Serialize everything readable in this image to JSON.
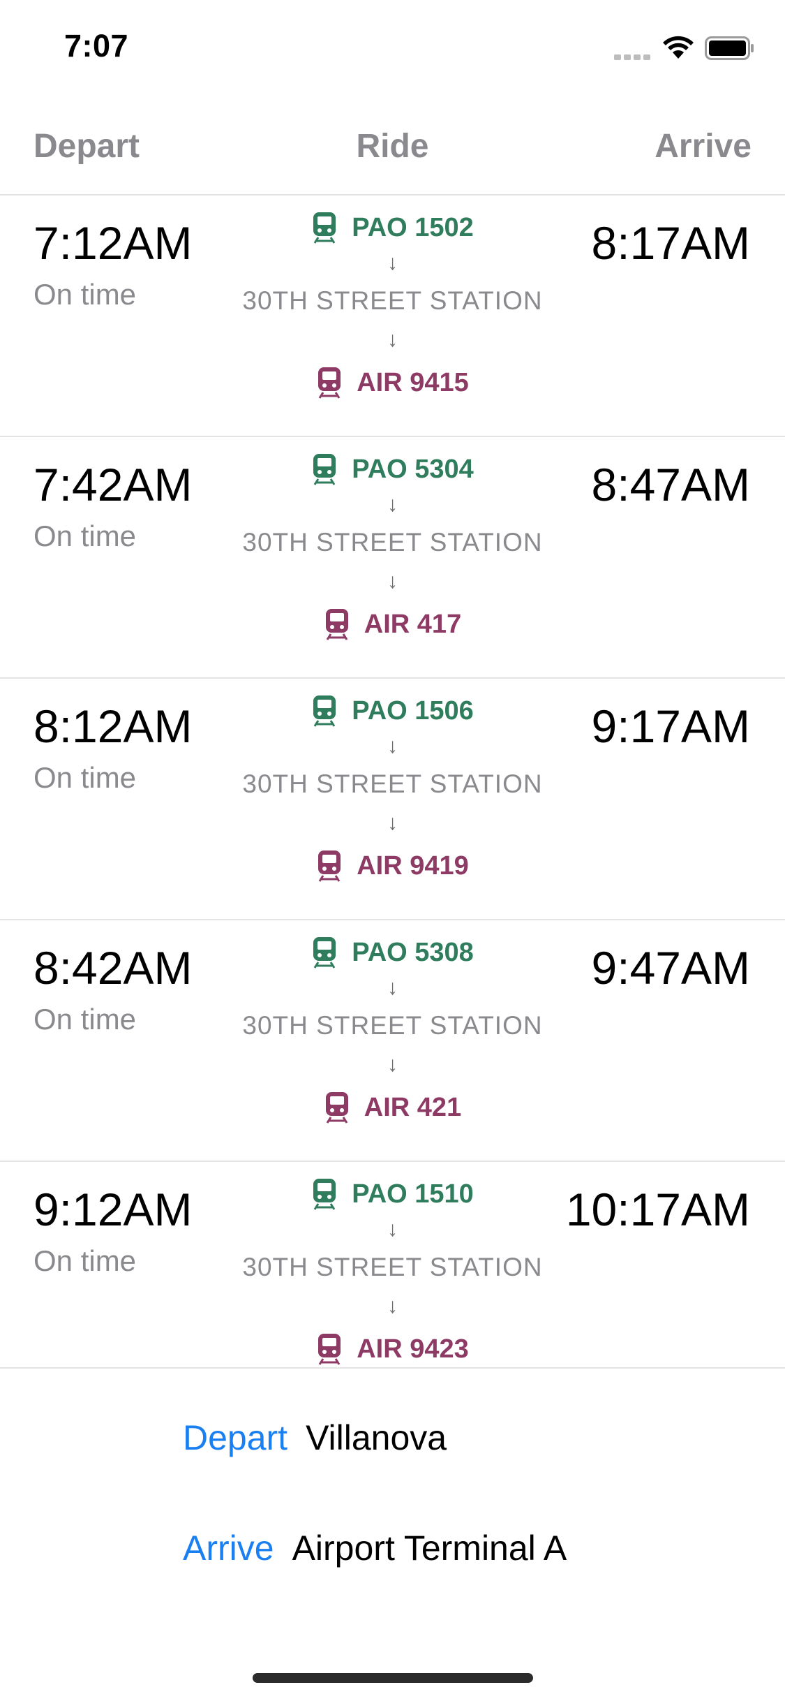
{
  "status_bar": {
    "time": "7:07",
    "icons": [
      "signal-dots-icon",
      "wifi-icon",
      "battery-icon"
    ]
  },
  "header": {
    "depart": "Depart",
    "ride": "Ride",
    "arrive": "Arrive"
  },
  "colors": {
    "leg1_green": "#2f7d5c",
    "leg2_magenta": "#8d3a64",
    "accent_blue": "#1a7ff0",
    "secondary_gray": "#8a8a8e"
  },
  "trips": [
    {
      "depart_time": "7:12AM",
      "status": "On time",
      "leg1": "PAO 1502",
      "arrow1": "↓",
      "transfer": "30TH STREET STATION",
      "arrow2": "↓",
      "leg2": "AIR 9415",
      "arrive_time": "8:17AM"
    },
    {
      "depart_time": "7:42AM",
      "status": "On time",
      "leg1": "PAO 5304",
      "arrow1": "↓",
      "transfer": "30TH STREET STATION",
      "arrow2": "↓",
      "leg2": "AIR 417",
      "arrive_time": "8:47AM"
    },
    {
      "depart_time": "8:12AM",
      "status": "On time",
      "leg1": "PAO 1506",
      "arrow1": "↓",
      "transfer": "30TH STREET STATION",
      "arrow2": "↓",
      "leg2": "AIR 9419",
      "arrive_time": "9:17AM"
    },
    {
      "depart_time": "8:42AM",
      "status": "On time",
      "leg1": "PAO 5308",
      "arrow1": "↓",
      "transfer": "30TH STREET STATION",
      "arrow2": "↓",
      "leg2": "AIR 421",
      "arrive_time": "9:47AM"
    },
    {
      "depart_time": "9:12AM",
      "status": "On time",
      "leg1": "PAO 1510",
      "arrow1": "↓",
      "transfer": "30TH STREET STATION",
      "arrow2": "↓",
      "leg2": "AIR 9423",
      "arrive_time": "10:17AM"
    }
  ],
  "picker": {
    "depart_label": "Depart",
    "depart_value": "Villanova",
    "arrive_label": "Arrive",
    "arrive_value": "Airport Terminal A"
  }
}
